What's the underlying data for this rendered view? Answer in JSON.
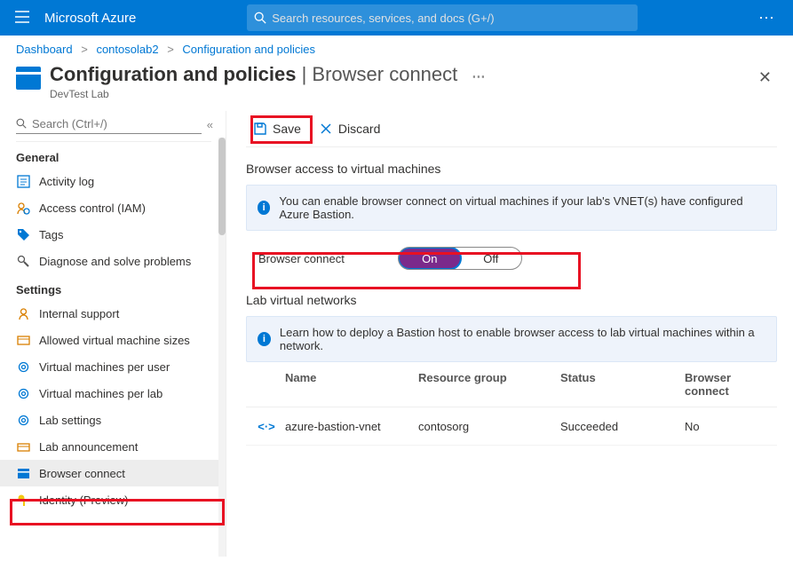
{
  "brand": "Microsoft Azure",
  "search_placeholder": "Search resources, services, and docs (G+/)",
  "breadcrumbs": {
    "a": "Dashboard",
    "b": "contosolab2",
    "c": "Configuration and policies"
  },
  "page": {
    "title_primary": "Configuration and policies",
    "title_secondary": "Browser connect",
    "subtitle": "DevTest Lab"
  },
  "side_search_placeholder": "Search (Ctrl+/)",
  "sidebar": {
    "section_general": "General",
    "activity_log": "Activity log",
    "access_control": "Access control (IAM)",
    "tags": "Tags",
    "diagnose": "Diagnose and solve problems",
    "section_settings": "Settings",
    "internal_support": "Internal support",
    "allowed_vm_sizes": "Allowed virtual machine sizes",
    "vms_per_user": "Virtual machines per user",
    "vms_per_lab": "Virtual machines per lab",
    "lab_settings": "Lab settings",
    "lab_announcement": "Lab announcement",
    "browser_connect": "Browser connect",
    "identity": "Identity (Preview)"
  },
  "commands": {
    "save": "Save",
    "discard": "Discard"
  },
  "main": {
    "section1": "Browser access to virtual machines",
    "info1": "You can enable browser connect on virtual machines if your lab's VNET(s) have configured Azure Bastion.",
    "toggle_label": "Browser connect",
    "toggle_on": "On",
    "toggle_off": "Off",
    "section2": "Lab virtual networks",
    "info2": "Learn how to deploy a Bastion host to enable browser access to lab virtual machines within a network.",
    "cols": {
      "name": "Name",
      "rg": "Resource group",
      "status": "Status",
      "bc": "Browser connect"
    },
    "row": {
      "name": "azure-bastion-vnet",
      "rg": "contosorg",
      "status": "Succeeded",
      "bc": "No"
    }
  }
}
